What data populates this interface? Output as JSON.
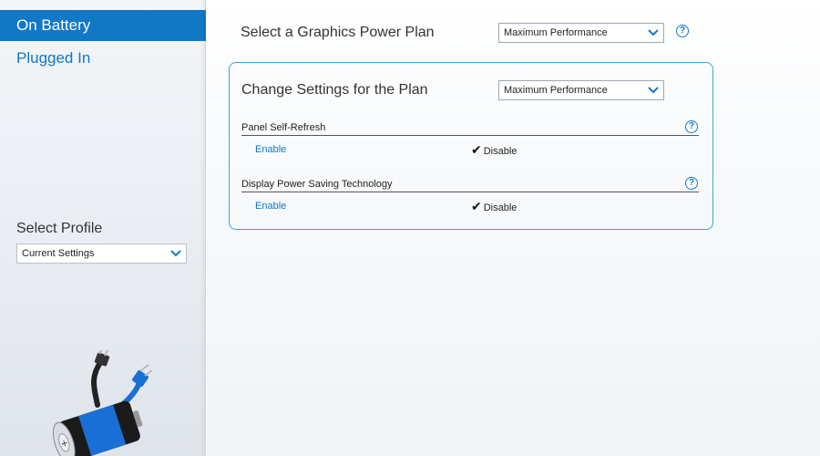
{
  "sidebar": {
    "items": [
      {
        "label": "On Battery",
        "active": true
      },
      {
        "label": "Plugged In",
        "active": false
      }
    ],
    "profile_label": "Select Profile",
    "profile_value": "Current Settings"
  },
  "main": {
    "plan_title": "Select a Graphics Power Plan",
    "plan_value": "Maximum Performance",
    "card": {
      "title": "Change Settings for the Plan",
      "plan_value": "Maximum Performance",
      "settings": [
        {
          "label": "Panel Self-Refresh",
          "enable_label": "Enable",
          "disable_label": "Disable",
          "selected": "Disable"
        },
        {
          "label": "Display Power Saving Technology",
          "enable_label": "Enable",
          "disable_label": "Disable",
          "selected": "Disable"
        }
      ]
    },
    "help_glyph": "?"
  },
  "colors": {
    "accent": "#1178c8",
    "card_border": "#3aa7d9",
    "battery_blue": "#1a6fd6"
  },
  "icons": {
    "dropdown": "chevron-down-icon",
    "help": "help-icon",
    "check": "checkmark-icon",
    "battery": "battery-plug-illustration"
  }
}
